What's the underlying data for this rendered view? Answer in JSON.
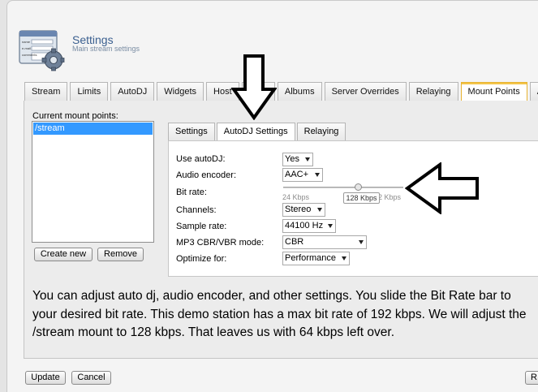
{
  "header": {
    "title": "Settings",
    "subtitle": "Main stream settings",
    "icon": "settings-form-gear-icon",
    "icon_text": [
      "name",
      "e-mail",
      "comments"
    ]
  },
  "tabs": [
    {
      "label": "Stream",
      "active": false
    },
    {
      "label": "Limits",
      "active": false
    },
    {
      "label": "AutoDJ",
      "active": false
    },
    {
      "label": "Widgets",
      "active": false
    },
    {
      "label": "Host",
      "active": false
    },
    {
      "label": "Files",
      "active": false
    },
    {
      "label": "Albums",
      "active": false
    },
    {
      "label": "Server Overrides",
      "active": false
    },
    {
      "label": "Relaying",
      "active": false
    },
    {
      "label": "Mount Points",
      "active": true
    },
    {
      "label": "A",
      "active": false
    }
  ],
  "mounts": {
    "label": "Current mount points:",
    "items": [
      "/stream"
    ],
    "create_label": "Create new",
    "remove_label": "Remove"
  },
  "inner_tabs": [
    {
      "label": "Settings",
      "active": false
    },
    {
      "label": "AutoDJ Settings",
      "active": true
    },
    {
      "label": "Relaying",
      "active": false
    }
  ],
  "form": {
    "use_autodj": {
      "label": "Use autoDJ:",
      "value": "Yes"
    },
    "audio_encoder": {
      "label": "Audio encoder:",
      "value": "AAC+"
    },
    "bit_rate": {
      "label": "Bit rate:",
      "min_label": "24 Kbps",
      "max_label": "2 Kbps",
      "value_label": "128 Kbps",
      "fraction": 0.6
    },
    "channels": {
      "label": "Channels:",
      "value": "Stereo"
    },
    "sample_rate": {
      "label": "Sample rate:",
      "value": "44100 Hz"
    },
    "mp3_mode": {
      "label": "MP3 CBR/VBR mode:",
      "value": "CBR"
    },
    "optimize": {
      "label": "Optimize for:",
      "value": "Performance"
    }
  },
  "annotation": "You can adjust auto dj, audio encoder, and other settings. You slide the Bit Rate bar to your desired bit rate. This demo station has a max bit rate of 192 kbps. We will adjust the /stream mount to 128 kbps. That leaves us with 64 kbps left over.",
  "footer": {
    "update_label": "Update",
    "cancel_label": "Cancel",
    "right_button_label": "R"
  },
  "colors": {
    "title": "#3a5f8f",
    "selection": "#3399ff",
    "active_tab_border": "#e7b230"
  }
}
